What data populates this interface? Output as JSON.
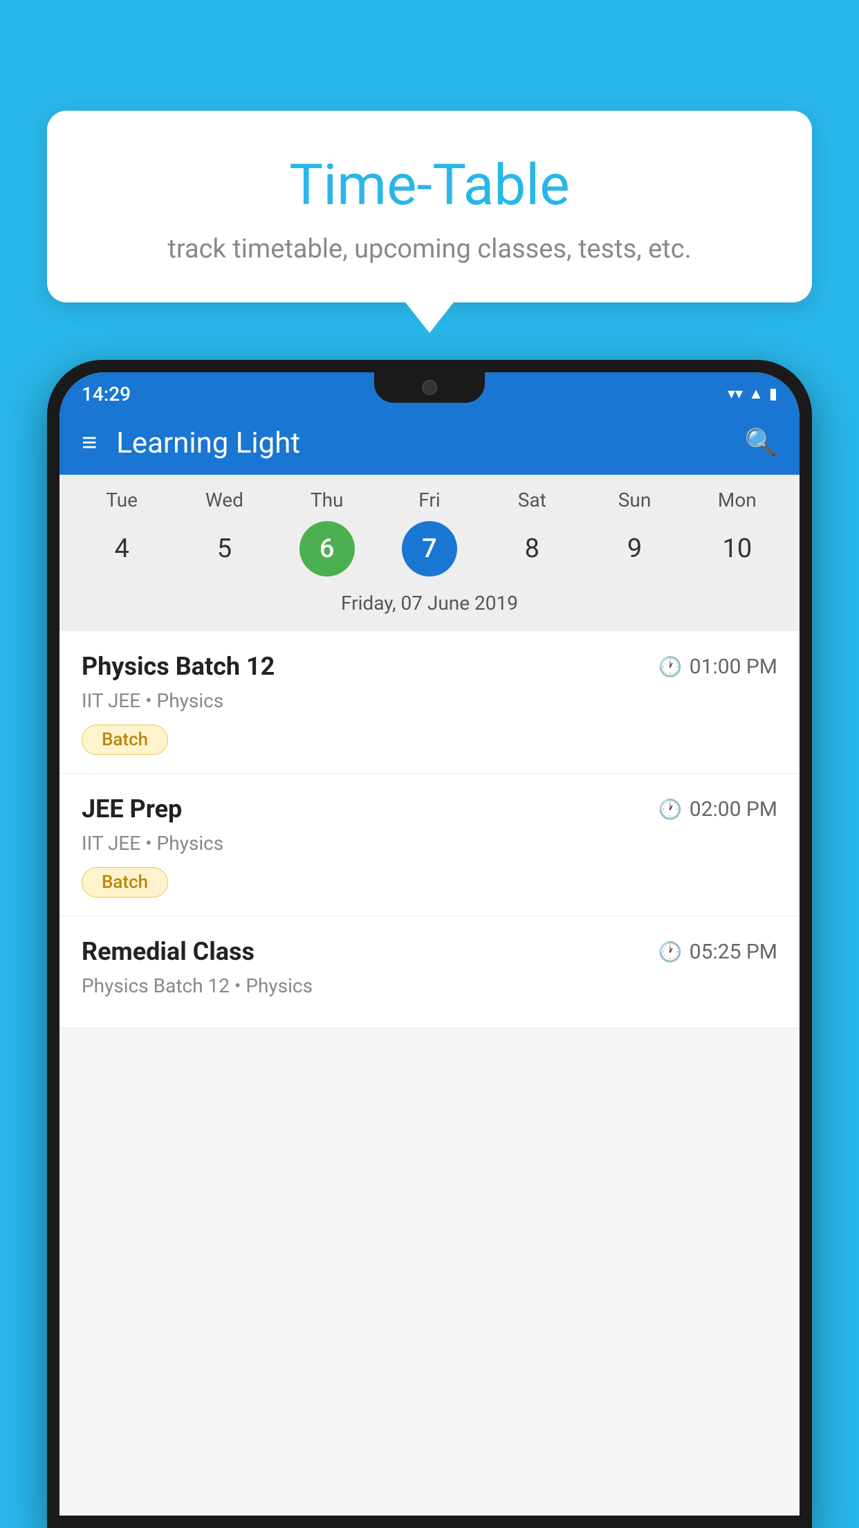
{
  "background_color": "#29b6e8",
  "tooltip": {
    "title": "Time-Table",
    "subtitle": "track timetable, upcoming classes, tests, etc."
  },
  "phone": {
    "status_bar": {
      "time": "14:29",
      "icons": [
        "wifi",
        "signal",
        "battery"
      ]
    },
    "app_bar": {
      "title": "Learning Light",
      "hamburger_label": "≡",
      "search_label": "🔍"
    },
    "calendar": {
      "days": [
        {
          "label": "Tue",
          "num": "4"
        },
        {
          "label": "Wed",
          "num": "5"
        },
        {
          "label": "Thu",
          "num": "6",
          "state": "today"
        },
        {
          "label": "Fri",
          "num": "7",
          "state": "selected"
        },
        {
          "label": "Sat",
          "num": "8"
        },
        {
          "label": "Sun",
          "num": "9"
        },
        {
          "label": "Mon",
          "num": "10"
        }
      ],
      "selected_date_label": "Friday, 07 June 2019"
    },
    "schedule_items": [
      {
        "title": "Physics Batch 12",
        "time": "01:00 PM",
        "subtitle": "IIT JEE • Physics",
        "tag": "Batch"
      },
      {
        "title": "JEE Prep",
        "time": "02:00 PM",
        "subtitle": "IIT JEE • Physics",
        "tag": "Batch"
      },
      {
        "title": "Remedial Class",
        "time": "05:25 PM",
        "subtitle": "Physics Batch 12 • Physics",
        "tag": ""
      }
    ]
  }
}
